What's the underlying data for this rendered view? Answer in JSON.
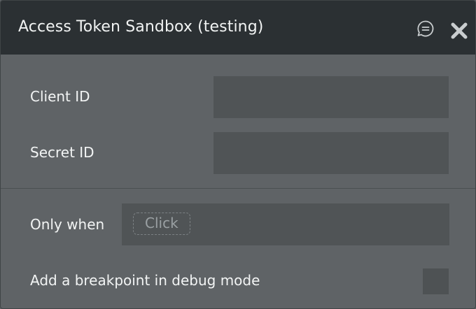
{
  "window": {
    "title": "Access Token Sandbox (testing)"
  },
  "fields": {
    "client_id_label": "Client ID",
    "client_id_value": "",
    "secret_id_label": "Secret ID",
    "secret_id_value": ""
  },
  "condition": {
    "label": "Only when",
    "placeholder_chip": "Click"
  },
  "debug": {
    "label": "Add a breakpoint in debug mode",
    "checked": false
  },
  "icons": {
    "comment": "comment-icon",
    "close": "close-icon"
  },
  "colors": {
    "titlebar": "#2b3033",
    "panel": "#5f6366",
    "field": "#505456",
    "text": "#f2f4f4"
  }
}
